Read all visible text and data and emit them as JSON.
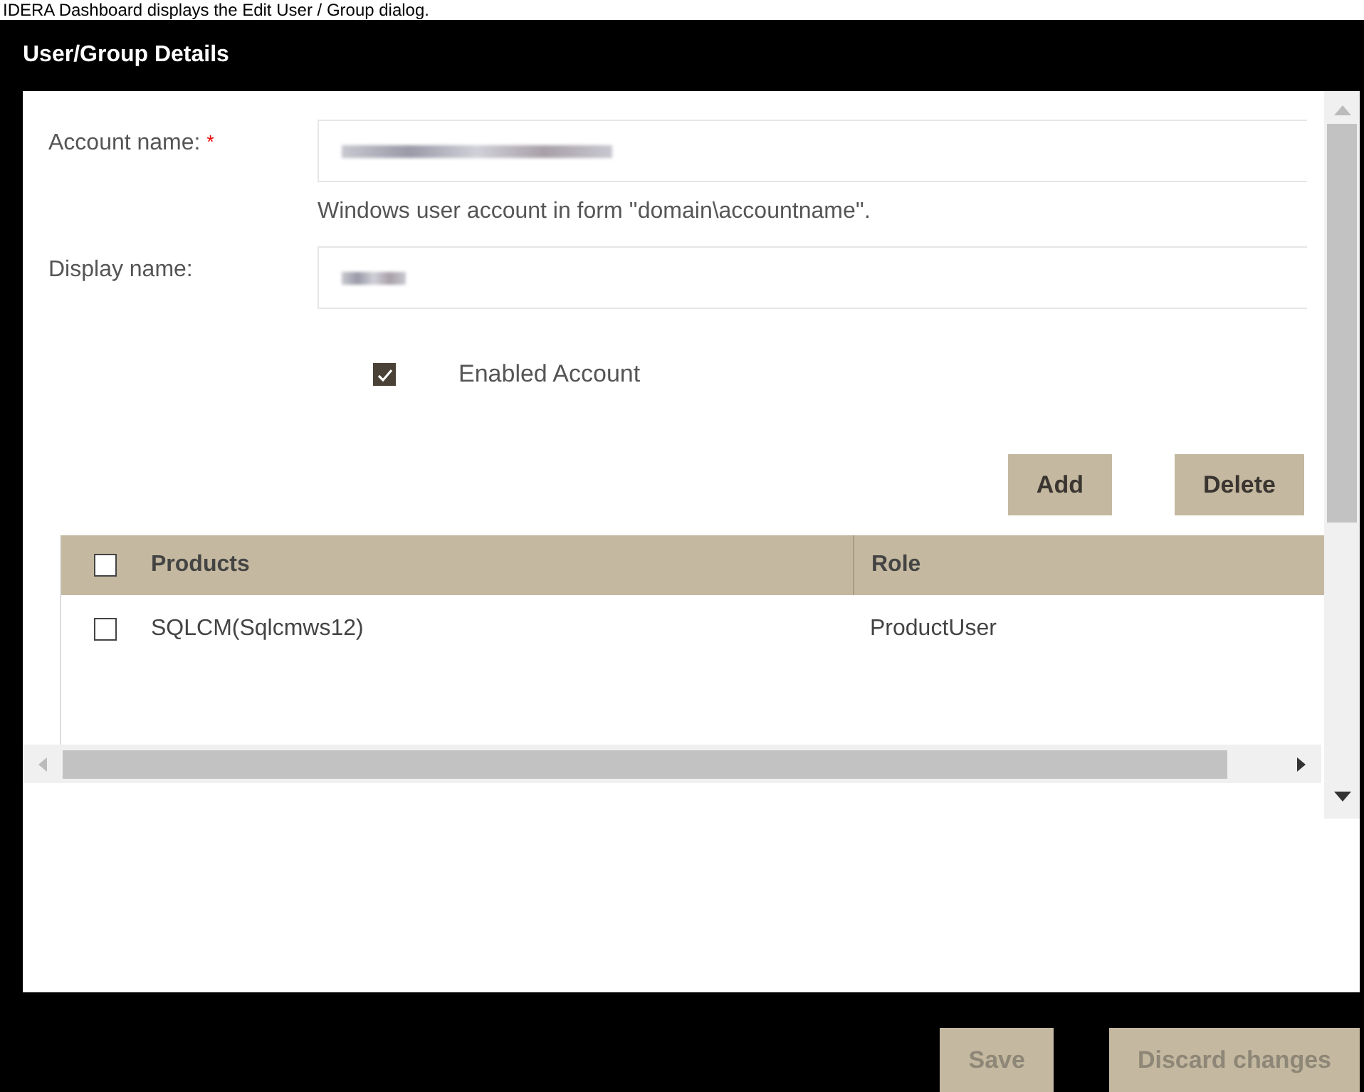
{
  "caption": "IDERA Dashboard displays the Edit User / Group dialog.",
  "dialog": {
    "title": "User/Group Details",
    "fields": [
      {
        "label": "Account name:",
        "required_mark": "*",
        "hint": "Windows user account in form ''domain\\accountname''."
      },
      {
        "label": "Display name:"
      }
    ],
    "enabled_checkbox": {
      "label": "Enabled Account",
      "checked": true
    },
    "actions": [
      {
        "label": "Add",
        "disabled": false
      },
      {
        "label": "Delete",
        "disabled": false
      }
    ],
    "table": {
      "select_all_checked": false,
      "columns": [
        "Products",
        "Role"
      ],
      "rows": [
        {
          "checked": false,
          "cells": [
            "SQLCM(Sqlcmws12)",
            "ProductUser"
          ]
        }
      ]
    },
    "footer_buttons": [
      {
        "label": "Save",
        "disabled": true
      },
      {
        "label": "Discard changes",
        "disabled": true
      }
    ]
  }
}
